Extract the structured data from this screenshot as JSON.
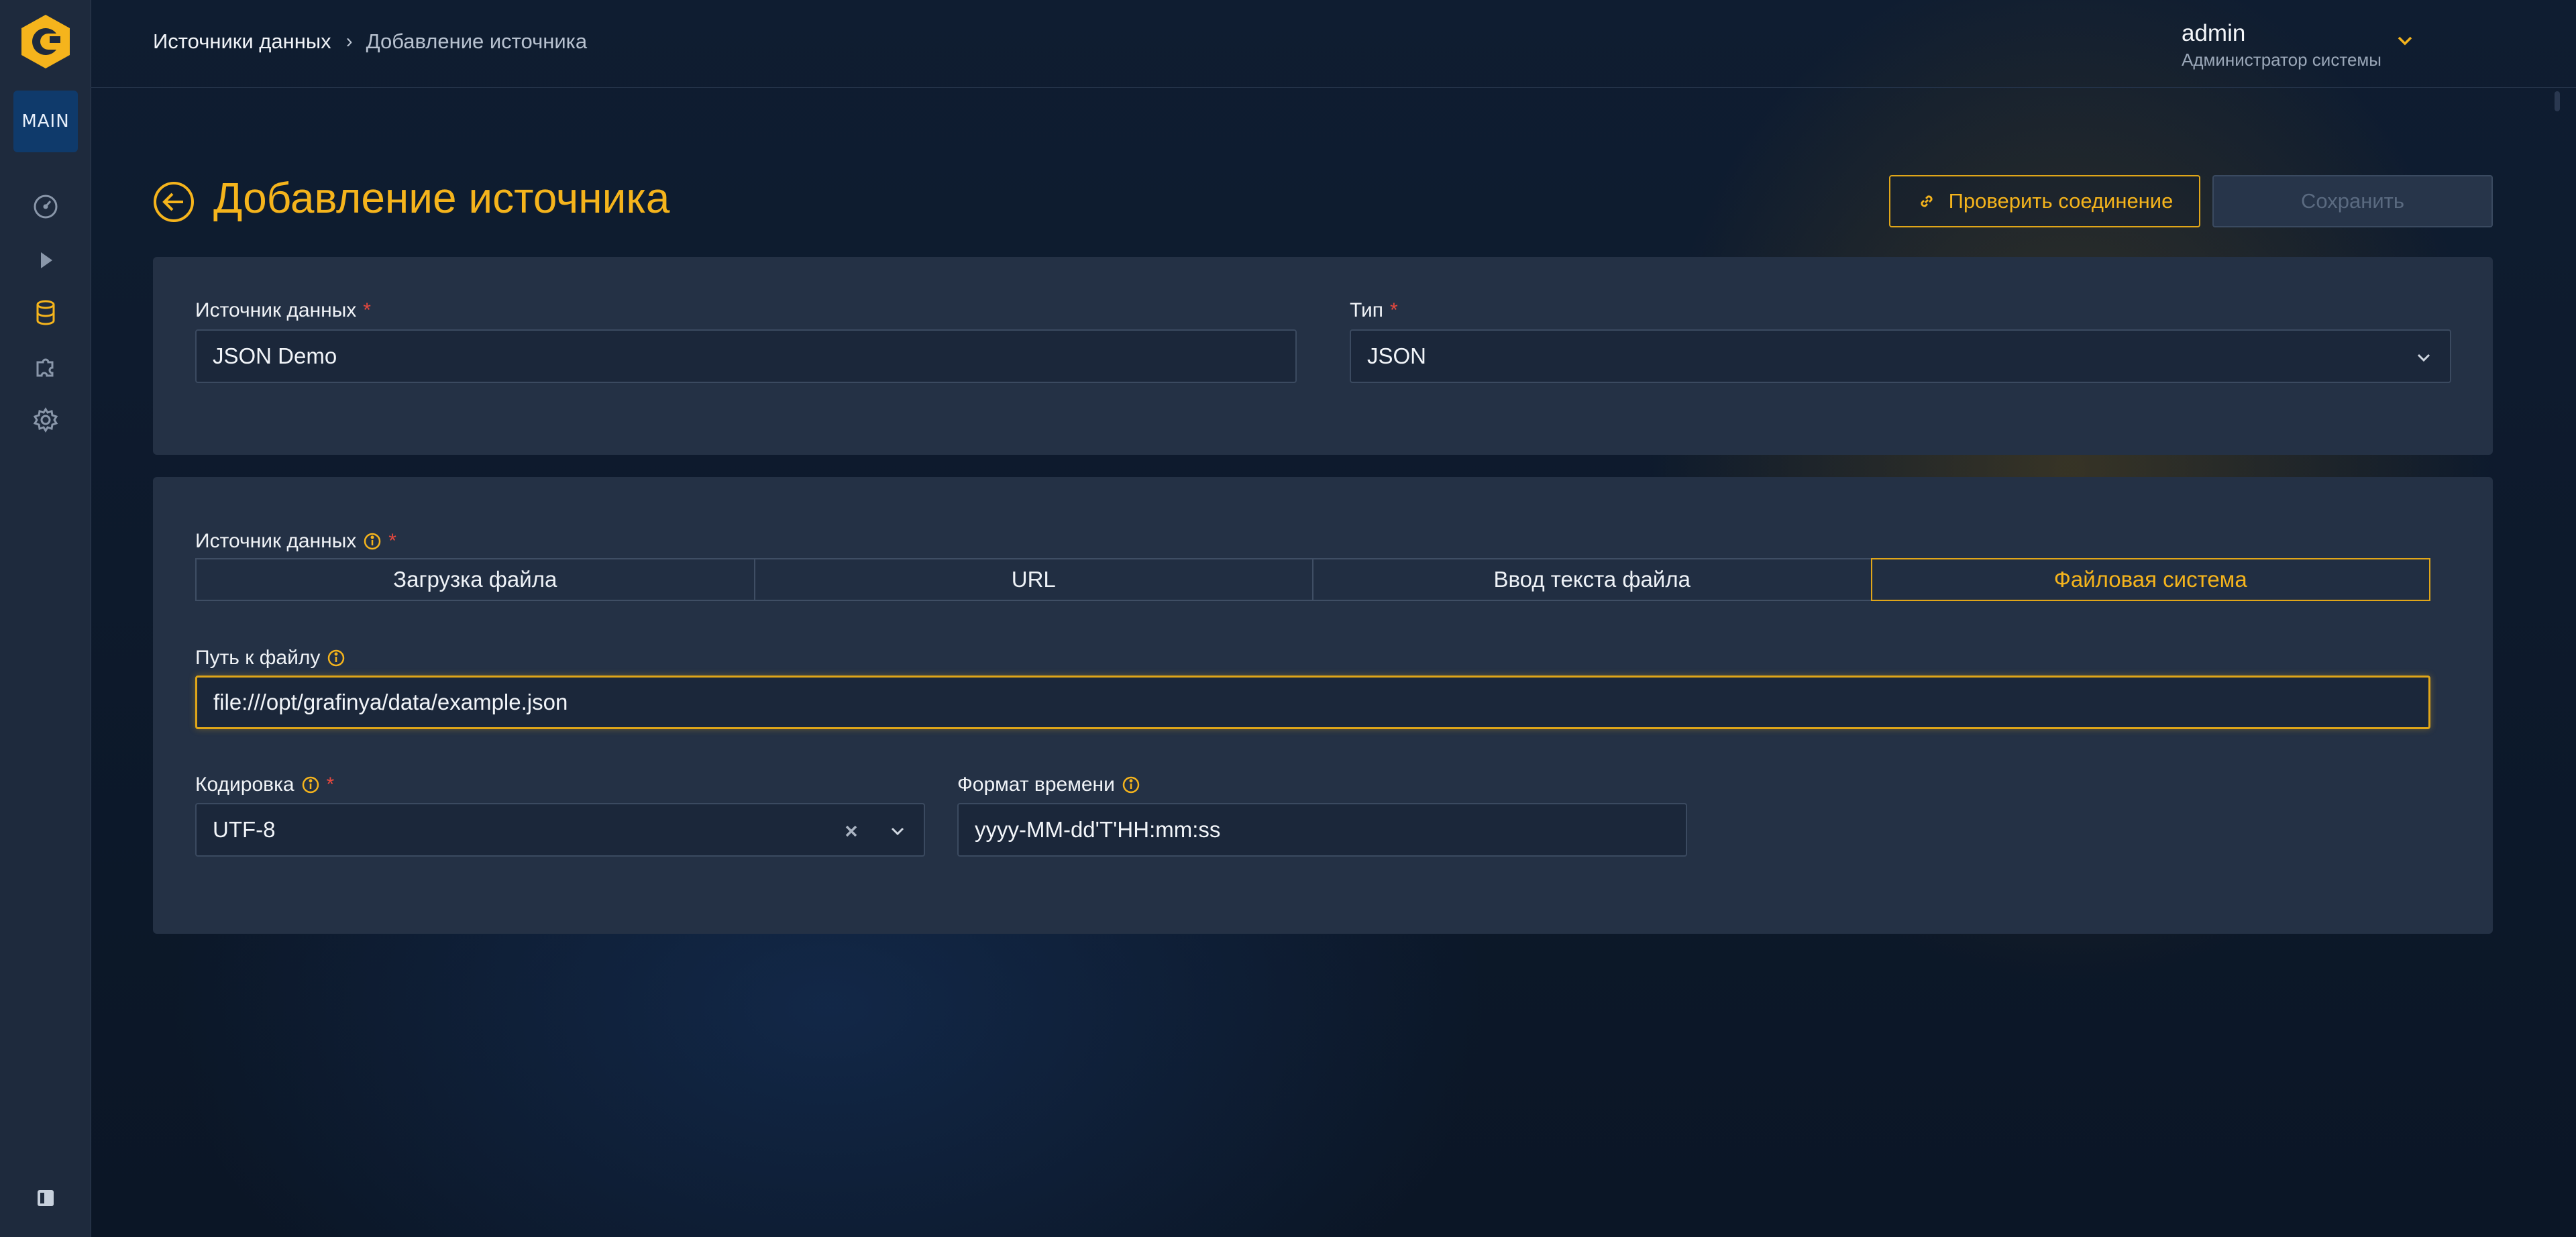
{
  "sidebar": {
    "workspace_badge": "MAIN",
    "items": [
      {
        "icon": "dashboard-gauge-icon"
      },
      {
        "icon": "play-icon"
      },
      {
        "icon": "database-icon",
        "active": true
      },
      {
        "icon": "puzzle-plugin-icon"
      },
      {
        "icon": "gear-icon"
      }
    ],
    "collapse_icon": "sidebar-collapse-icon"
  },
  "header": {
    "breadcrumb": {
      "parent": "Источники данных",
      "separator": "›",
      "current": "Добавление источника"
    },
    "user": {
      "name": "admin",
      "role": "Администратор системы"
    }
  },
  "page": {
    "title": "Добавление источника",
    "check_button": "Проверить соединение",
    "save_button": "Сохранить"
  },
  "form": {
    "source_name": {
      "label": "Источник данных",
      "required_mark": "*",
      "value": "JSON Demo"
    },
    "type": {
      "label": "Тип",
      "required_mark": "*",
      "value": "JSON"
    },
    "source_mode": {
      "label": "Источник данных",
      "required_mark": "*",
      "options": [
        "Загрузка файла",
        "URL",
        "Ввод текста файла",
        "Файловая система"
      ],
      "selected": "Файловая система"
    },
    "file_path": {
      "label": "Путь к файлу",
      "value": "file:///opt/grafinya/data/example.json"
    },
    "encoding": {
      "label": "Кодировка",
      "required_mark": "*",
      "value": "UTF-8"
    },
    "time_format": {
      "label": "Формат времени",
      "value": "yyyy-MM-dd'T'HH:mm:ss"
    }
  },
  "colors": {
    "accent": "#f5b41c",
    "required": "#e4483e",
    "card": "#243145",
    "sidebar": "#1e2a3d"
  }
}
